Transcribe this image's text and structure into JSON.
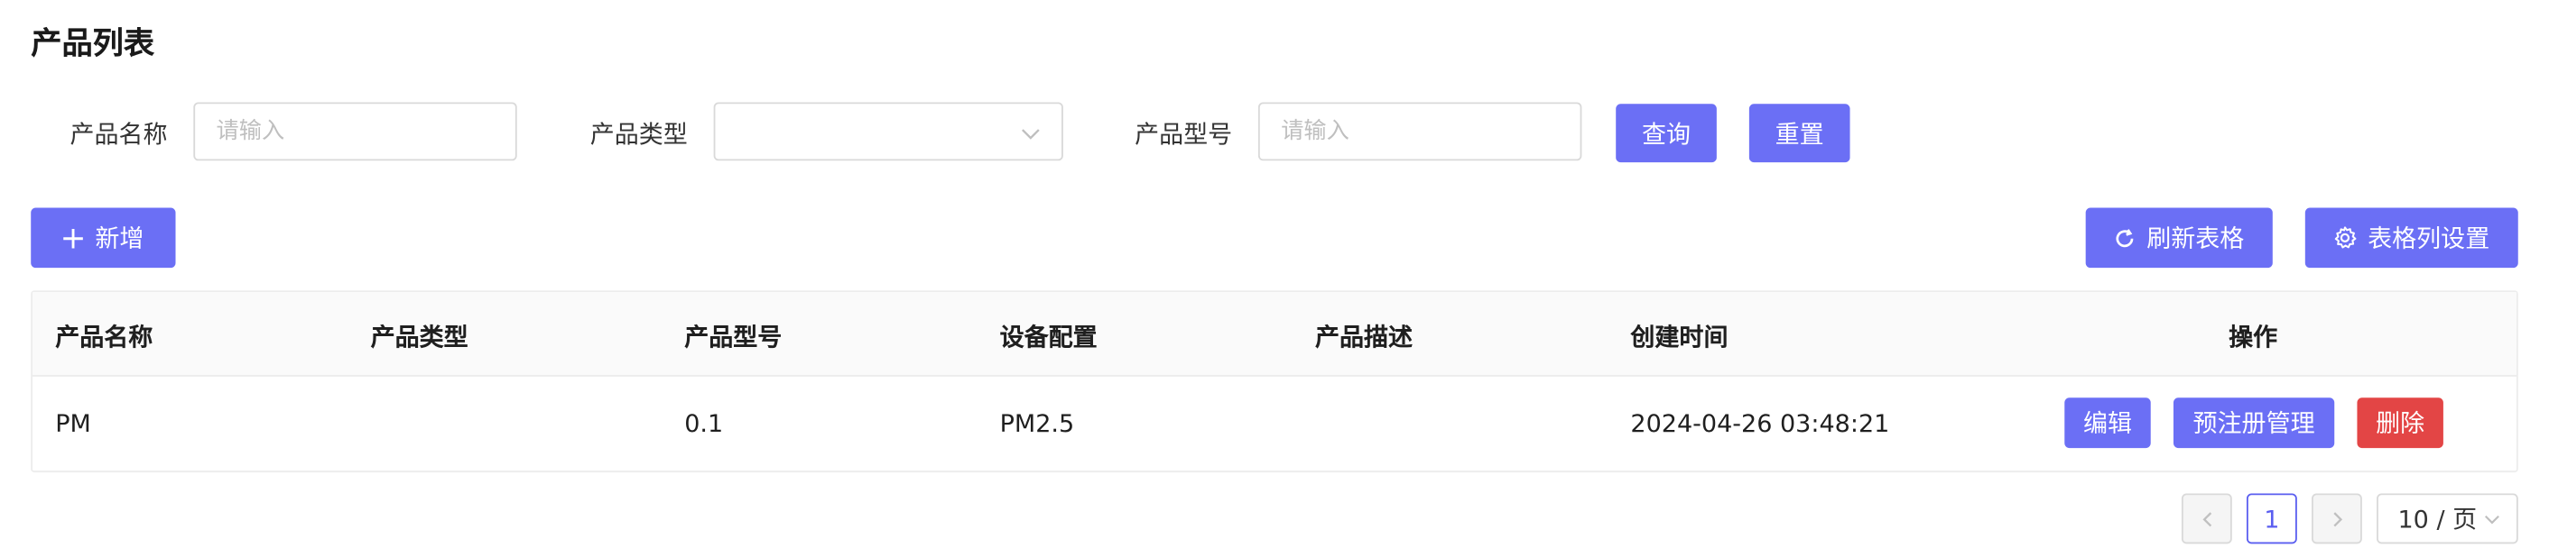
{
  "page": {
    "title": "产品列表"
  },
  "search": {
    "name_label": "产品名称",
    "name_placeholder": "请输入",
    "type_label": "产品类型",
    "type_value": "",
    "model_label": "产品型号",
    "model_placeholder": "请输入",
    "query_label": "查询",
    "reset_label": "重置"
  },
  "toolbar": {
    "add_label": "新增",
    "refresh_label": "刷新表格",
    "columns_label": "表格列设置"
  },
  "table": {
    "columns": [
      "产品名称",
      "产品类型",
      "产品型号",
      "设备配置",
      "产品描述",
      "创建时间",
      "操作"
    ],
    "rows": [
      {
        "name": "PM",
        "type": "",
        "model": "0.1",
        "config": "PM2.5",
        "desc": "",
        "created": "2024-04-26 03:48:21",
        "actions": {
          "edit": "编辑",
          "prereg": "预注册管理",
          "delete": "删除"
        }
      }
    ]
  },
  "pagination": {
    "current_page": "1",
    "page_size": "10 / 页"
  },
  "colors": {
    "primary": "#6b6ff5",
    "danger": "#e34545",
    "header_bg": "#fafafa"
  },
  "icons": [
    "plus-icon",
    "refresh-icon",
    "gear-icon",
    "chevron-down-icon",
    "chevron-left-icon",
    "chevron-right-icon"
  ]
}
